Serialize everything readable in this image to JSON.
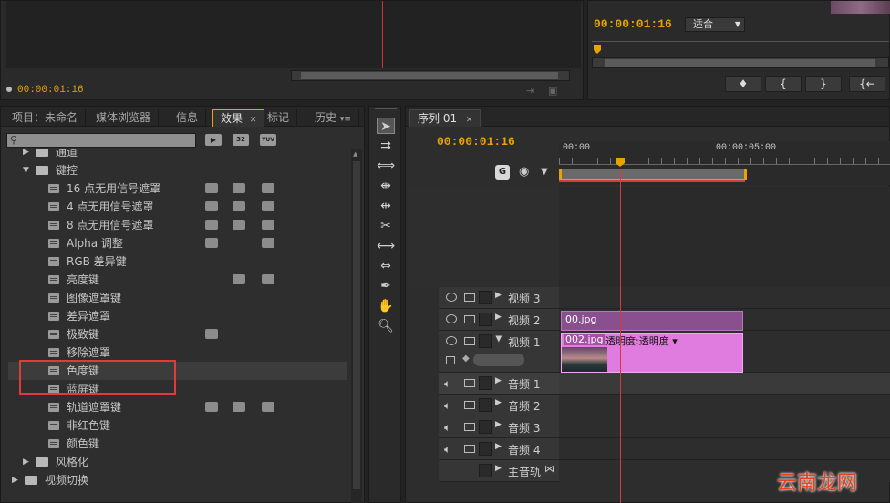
{
  "source_monitor": {
    "timecode": "00:00:01:16"
  },
  "program_monitor": {
    "timecode": "00:00:01:16",
    "fit_select": "适合",
    "buttons": [
      "♦",
      "{",
      "}",
      "{←"
    ]
  },
  "effects_panel": {
    "tabs": [
      "项目：未命名",
      "媒体浏览器",
      "信息",
      "效果",
      "标记",
      "历史"
    ],
    "active_tab": "效果",
    "search_placeholder": "",
    "badge_labels": [
      "32",
      "YUV"
    ],
    "tree": [
      {
        "label": "通道",
        "type": "folder",
        "level": 1
      },
      {
        "label": "键控",
        "type": "folder",
        "level": 1,
        "expanded": true
      },
      {
        "label": "16 点无用信号遮罩",
        "type": "effect",
        "level": 2,
        "badges": [
          1,
          1,
          1
        ]
      },
      {
        "label": "4 点无用信号遮罩",
        "type": "effect",
        "level": 2,
        "badges": [
          1,
          1,
          1
        ]
      },
      {
        "label": "8 点无用信号遮罩",
        "type": "effect",
        "level": 2,
        "badges": [
          1,
          1,
          1
        ]
      },
      {
        "label": "Alpha 调整",
        "type": "effect",
        "level": 2,
        "badges": [
          1,
          0,
          1
        ]
      },
      {
        "label": "RGB 差异键",
        "type": "effect",
        "level": 2,
        "badges": [
          0,
          0,
          0
        ]
      },
      {
        "label": "亮度键",
        "type": "effect",
        "level": 2,
        "badges": [
          0,
          1,
          1
        ]
      },
      {
        "label": "图像遮罩键",
        "type": "effect",
        "level": 2,
        "badges": [
          0,
          0,
          0
        ]
      },
      {
        "label": "差异遮罩",
        "type": "effect",
        "level": 2,
        "badges": [
          0,
          0,
          0
        ]
      },
      {
        "label": "极致键",
        "type": "effect",
        "level": 2,
        "badges": [
          1,
          0,
          0
        ]
      },
      {
        "label": "移除遮罩",
        "type": "effect",
        "level": 2,
        "badges": [
          0,
          0,
          0
        ]
      },
      {
        "label": "色度键",
        "type": "effect",
        "level": 2,
        "badges": [
          0,
          0,
          0
        ],
        "selected": true
      },
      {
        "label": "蓝屏键",
        "type": "effect",
        "level": 2,
        "badges": [
          0,
          0,
          0
        ]
      },
      {
        "label": "轨道遮罩键",
        "type": "effect",
        "level": 2,
        "badges": [
          1,
          1,
          1
        ]
      },
      {
        "label": "非红色键",
        "type": "effect",
        "level": 2,
        "badges": [
          0,
          0,
          0
        ]
      },
      {
        "label": "颜色键",
        "type": "effect",
        "level": 2,
        "badges": [
          0,
          0,
          0
        ]
      },
      {
        "label": "风格化",
        "type": "folder",
        "level": 1
      },
      {
        "label": "视频切换",
        "type": "folder",
        "level": 0
      }
    ]
  },
  "timeline": {
    "tab": "序列 01",
    "timecode": "00:00:01:16",
    "ruler": [
      "00:00",
      "00:00:05:00"
    ],
    "tracks": {
      "v3": "视频 3",
      "v2": "视频 2",
      "v1": "视频 1",
      "a1": "音频 1",
      "a2": "音频 2",
      "a3": "音频 3",
      "a4": "音频 4",
      "master": "主音轨"
    },
    "clips": {
      "v2_clip": "00.jpg",
      "v1_clip": "002.jpg",
      "v1_effect": "透明度:透明度 ▾"
    }
  },
  "watermark": "云南龙网",
  "colors": {
    "accent": "#e8a300",
    "playhead": "#d43b3b",
    "clip_purple": "#8a4f8f",
    "clip_pink": "#e07ce0",
    "highlight_box": "#e03a3a"
  }
}
